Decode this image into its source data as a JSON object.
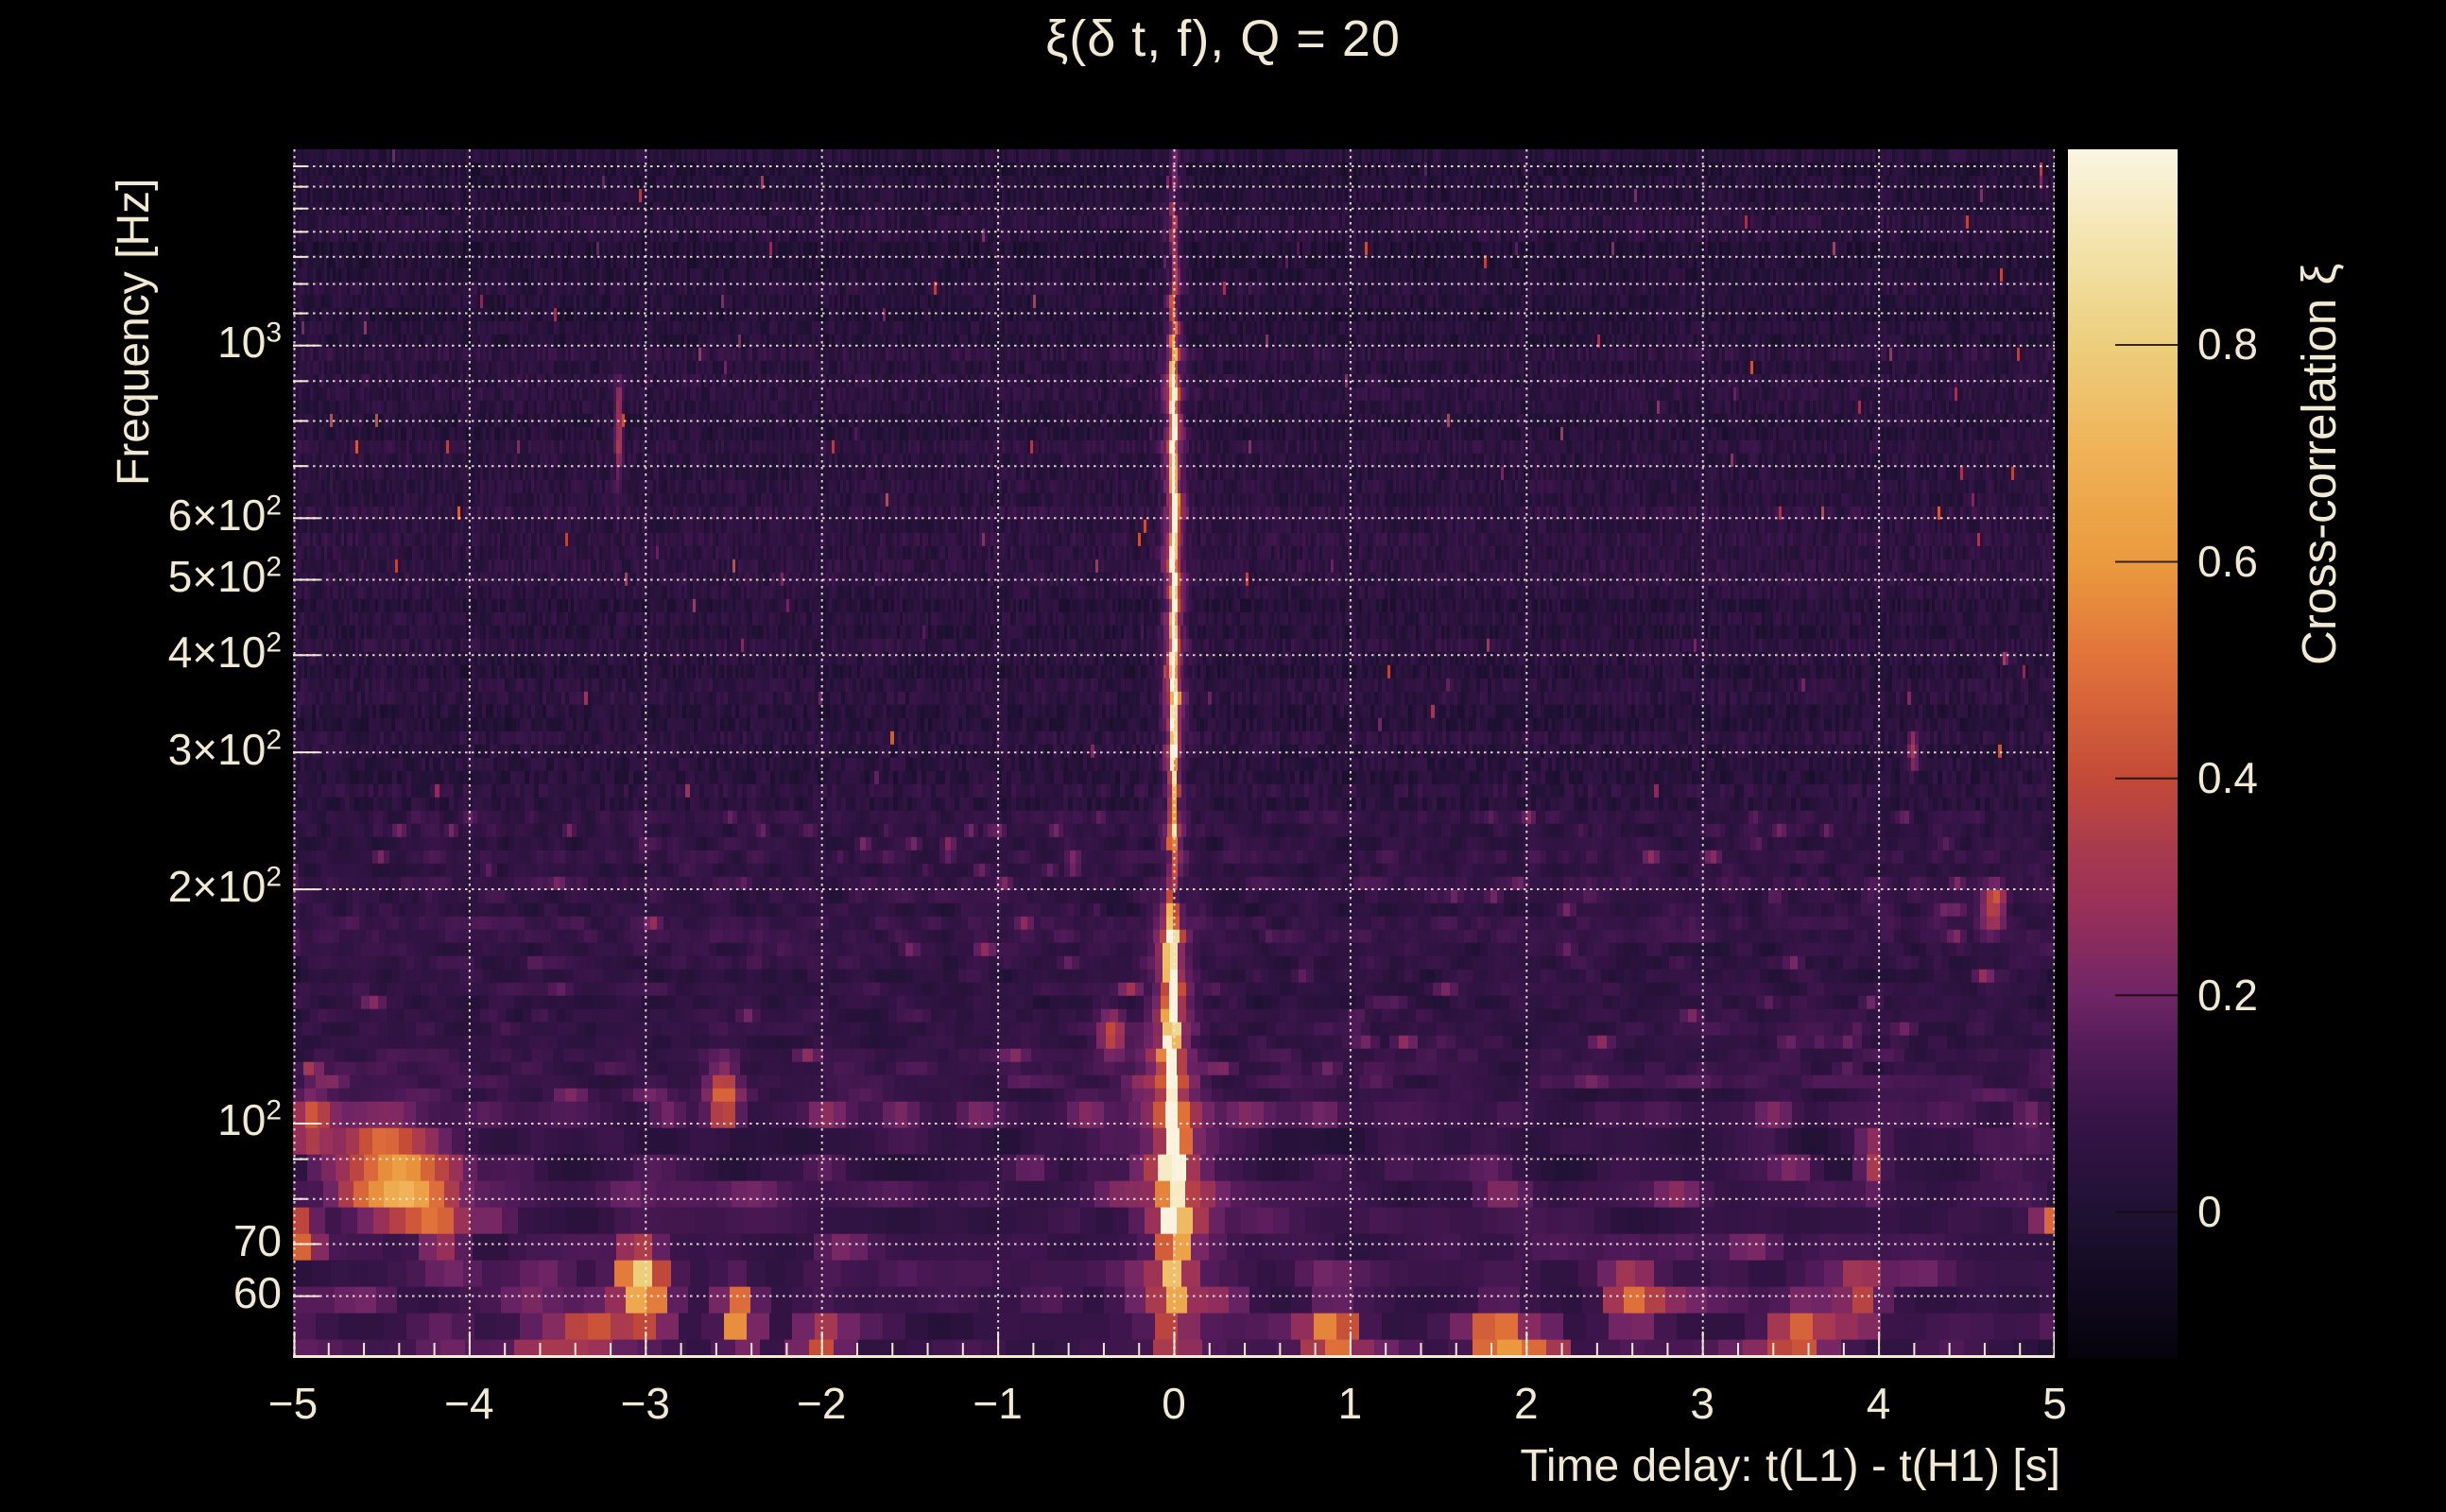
{
  "colors": {
    "background": "#000000",
    "text": "#f2e9d2",
    "axis": "#f2ead4",
    "gridline": "#f4eddb"
  },
  "chart_data": {
    "type": "heatmap",
    "title": "ξ(δ t, f), Q = 20",
    "q_value": 20,
    "xlabel": "Time delay: t(L1) - t(H1) [s]",
    "ylabel": "Frequency [Hz]",
    "colorbar_label": "Cross-correlation ξ",
    "x_range": [
      -5,
      5
    ],
    "y_range_hz": [
      49.9,
      1785
    ],
    "y_scale": "log",
    "z_range": [
      -0.135,
      0.98
    ],
    "grid": "on",
    "x_ticks": [
      {
        "v": -5,
        "label": "−5"
      },
      {
        "v": -4,
        "label": "−4"
      },
      {
        "v": -3,
        "label": "−3"
      },
      {
        "v": -2,
        "label": "−2"
      },
      {
        "v": -1,
        "label": "−1"
      },
      {
        "v": 0,
        "label": "0"
      },
      {
        "v": 1,
        "label": "1"
      },
      {
        "v": 2,
        "label": "2"
      },
      {
        "v": 3,
        "label": "3"
      },
      {
        "v": 4,
        "label": "4"
      },
      {
        "v": 5,
        "label": "5"
      }
    ],
    "x_minor_tick_step": 0.2,
    "y_ticks": [
      {
        "f": 1000,
        "mant": "10",
        "exp": "3"
      },
      {
        "f": 600,
        "mant": "6×10",
        "exp": "2"
      },
      {
        "f": 500,
        "mant": "5×10",
        "exp": "2"
      },
      {
        "f": 400,
        "mant": "4×10",
        "exp": "2"
      },
      {
        "f": 300,
        "mant": "3×10",
        "exp": "2"
      },
      {
        "f": 200,
        "mant": "2×10",
        "exp": "2"
      },
      {
        "f": 100,
        "mant": "10",
        "exp": "2"
      },
      {
        "f": 70,
        "mant": "70",
        "exp": ""
      },
      {
        "f": 60,
        "mant": "60",
        "exp": ""
      }
    ],
    "gridline_freqs_hz": [
      60,
      70,
      80,
      90,
      100,
      200,
      300,
      400,
      500,
      600,
      700,
      800,
      900,
      1000,
      1100,
      1200,
      1300,
      1400,
      1500,
      1600,
      1700
    ],
    "colorbar_ticks": [
      {
        "v": 0.8,
        "label": "0.8"
      },
      {
        "v": 0.6,
        "label": "0.6"
      },
      {
        "v": 0.4,
        "label": "0.4"
      },
      {
        "v": 0.2,
        "label": "0.2"
      },
      {
        "v": 0.0,
        "label": "0"
      }
    ],
    "colormap_stops": [
      {
        "u": 0.0,
        "c": "#05030c"
      },
      {
        "u": 0.121,
        "c": "#1f1133"
      },
      {
        "u": 0.2,
        "c": "#371448"
      },
      {
        "u": 0.25,
        "c": "#4f1a57"
      },
      {
        "u": 0.3,
        "c": "#6f2566"
      },
      {
        "u": 0.38,
        "c": "#9c3157"
      },
      {
        "u": 0.42,
        "c": "#a83a4f"
      },
      {
        "u": 0.479,
        "c": "#c34a38"
      },
      {
        "u": 0.576,
        "c": "#e0713a"
      },
      {
        "u": 0.658,
        "c": "#ea9a3e"
      },
      {
        "u": 0.748,
        "c": "#f0b156"
      },
      {
        "u": 0.837,
        "c": "#ecce7c"
      },
      {
        "u": 0.92,
        "c": "#f3e3ab"
      },
      {
        "u": 1.0,
        "c": "#faf5e2"
      }
    ],
    "features": {
      "background_noise": {
        "typical_xi_range": [
          -0.1,
          0.2
        ],
        "note": "mostly dark purple field of narrow vertical time-bins; noisier magenta band below ~250 Hz, strongest below ~115 Hz"
      },
      "zero_lag_ridge": {
        "dt": 0.0,
        "f_span_hz": [
          50,
          1500
        ],
        "peak_xi": 0.97,
        "profile": [
          [
            50,
            55,
            0.25
          ],
          [
            55,
            70,
            0.5
          ],
          [
            70,
            85,
            0.8
          ],
          [
            85,
            108,
            0.93
          ],
          [
            108,
            145,
            0.8
          ],
          [
            145,
            180,
            0.9
          ],
          [
            180,
            230,
            0.55
          ],
          [
            230,
            280,
            0.72
          ],
          [
            280,
            330,
            0.88
          ],
          [
            330,
            620,
            0.96
          ],
          [
            620,
            900,
            0.9
          ],
          [
            900,
            1050,
            0.55
          ],
          [
            1050,
            1250,
            0.35
          ],
          [
            1250,
            1500,
            0.25
          ],
          [
            1500,
            1800,
            0.16
          ]
        ]
      },
      "hotspots": [
        {
          "dt": -4.5,
          "f": 90,
          "xi": 0.28,
          "sdt": 0.22,
          "slf": 0.04
        },
        {
          "dt": -4.35,
          "f": 83,
          "xi": 0.45,
          "sdt": 0.15,
          "slf": 0.035
        },
        {
          "dt": -4.15,
          "f": 74,
          "xi": 0.32,
          "sdt": 0.1,
          "slf": 0.03
        },
        {
          "dt": -4.9,
          "f": 100,
          "xi": 0.3,
          "sdt": 0.08,
          "slf": 0.03
        },
        {
          "dt": -3.05,
          "f": 64,
          "xi": 0.5,
          "sdt": 0.08,
          "slf": 0.03
        },
        {
          "dt": -2.98,
          "f": 59,
          "xi": 0.45,
          "sdt": 0.1,
          "slf": 0.03
        },
        {
          "dt": -3.3,
          "f": 54,
          "xi": 0.32,
          "sdt": 0.12,
          "slf": 0.03
        },
        {
          "dt": -3.6,
          "f": 50,
          "xi": 0.3,
          "sdt": 0.15,
          "slf": 0.03
        },
        {
          "dt": -2.47,
          "f": 56,
          "xi": 0.55,
          "sdt": 0.07,
          "slf": 0.03
        },
        {
          "dt": -2.55,
          "f": 108,
          "xi": 0.42,
          "sdt": 0.06,
          "slf": 0.025
        },
        {
          "dt": -2.0,
          "f": 52,
          "xi": 0.35,
          "sdt": 0.1,
          "slf": 0.03
        },
        {
          "dt": -3.15,
          "f": 780,
          "xi": 0.3,
          "sdt": 0.015,
          "slf": 0.05
        },
        {
          "dt": -0.35,
          "f": 130,
          "xi": 0.32,
          "sdt": 0.05,
          "slf": 0.02
        },
        {
          "dt": 0.9,
          "f": 53,
          "xi": 0.5,
          "sdt": 0.1,
          "slf": 0.03
        },
        {
          "dt": 1.85,
          "f": 51,
          "xi": 0.62,
          "sdt": 0.1,
          "slf": 0.035
        },
        {
          "dt": 2.1,
          "f": 50,
          "xi": 0.45,
          "sdt": 0.08,
          "slf": 0.03
        },
        {
          "dt": 2.6,
          "f": 60,
          "xi": 0.35,
          "sdt": 0.1,
          "slf": 0.03
        },
        {
          "dt": 3.55,
          "f": 53,
          "xi": 0.42,
          "sdt": 0.12,
          "slf": 0.03
        },
        {
          "dt": 3.96,
          "f": 89,
          "xi": 0.3,
          "sdt": 0.05,
          "slf": 0.025
        },
        {
          "dt": 3.9,
          "f": 60,
          "xi": 0.3,
          "sdt": 0.08,
          "slf": 0.03
        },
        {
          "dt": 4.65,
          "f": 190,
          "xi": 0.33,
          "sdt": 0.05,
          "slf": 0.02
        },
        {
          "dt": 4.2,
          "f": 300,
          "xi": 0.28,
          "sdt": 0.02,
          "slf": 0.02
        }
      ]
    }
  }
}
